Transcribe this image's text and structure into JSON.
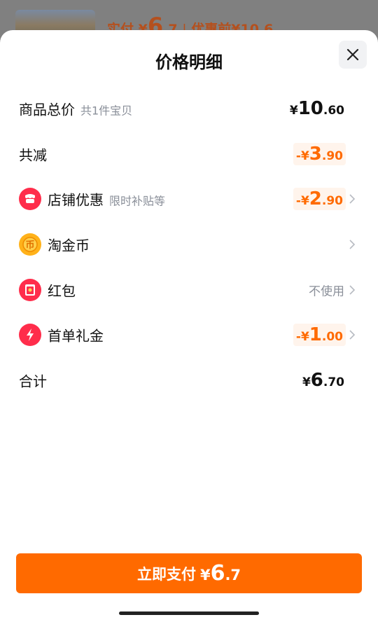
{
  "background": {
    "text_prefix": "实付",
    "currency": "¥",
    "amount_big": "6",
    "amount_rest": ".7",
    "divider": "|",
    "original_label": "优惠前",
    "original_amount": "¥10.6"
  },
  "sheet": {
    "title": "价格明细",
    "close_icon": "close-icon"
  },
  "rows": {
    "total": {
      "label": "商品总价",
      "sub": "共1件宝贝",
      "currency": "¥",
      "int": "10",
      "dec": ".60"
    },
    "reduce": {
      "label": "共减",
      "sign": "-",
      "currency": "¥",
      "int": "3",
      "dec": ".90"
    },
    "store_discount": {
      "label": "店铺优惠",
      "sub": "限时补贴等",
      "sign": "-",
      "currency": "¥",
      "int": "2",
      "dec": ".90",
      "icon": "store-icon"
    },
    "coins": {
      "label": "淘金币",
      "icon": "coin-icon"
    },
    "red_packet": {
      "label": "红包",
      "value": "不使用",
      "icon": "red-packet-icon"
    },
    "first_order": {
      "label": "首单礼金",
      "sign": "-",
      "currency": "¥",
      "int": "1",
      "dec": ".00",
      "icon": "lightning-icon"
    },
    "sum": {
      "label": "合计",
      "currency": "¥",
      "int": "6",
      "dec": ".70"
    }
  },
  "pay_button": {
    "label": "立即支付",
    "currency": "¥",
    "int": "6",
    "dec": ".7"
  },
  "colors": {
    "accent": "#ff6a00",
    "store_red": "#ff2d4b",
    "coin_yellow": "#ffb21a"
  }
}
